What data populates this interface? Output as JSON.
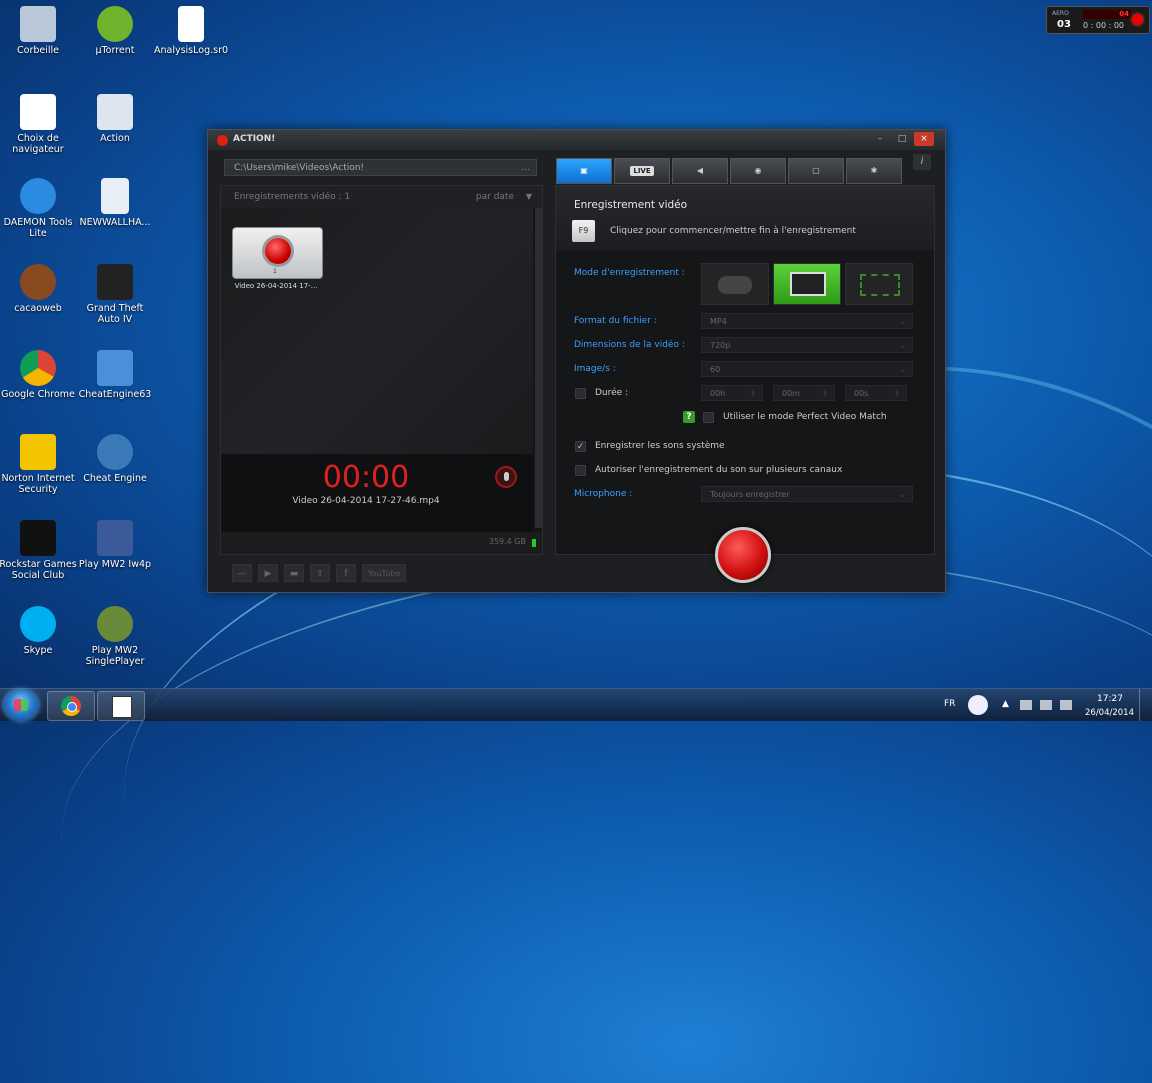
{
  "desktop_icons": [
    {
      "label": "Corbeille",
      "icon": "recycle-bin-icon",
      "color": "#b8c8d8"
    },
    {
      "label": "µTorrent",
      "icon": "utorrent-icon",
      "color": "#6fb42c"
    },
    {
      "label": "AnalysisLog.sr0",
      "icon": "file-icon",
      "color": "#ffffff"
    },
    {
      "label": "Choix de navigateur",
      "icon": "checklist-icon",
      "color": "#ffffff"
    },
    {
      "label": "Action",
      "icon": "calculator-icon",
      "color": "#dde6f0"
    },
    {
      "label": "DAEMON Tools Lite",
      "icon": "lightning-icon",
      "color": "#2a8be0"
    },
    {
      "label": "NEWWALLHA...",
      "icon": "settings-file-icon",
      "color": "#e8eef5"
    },
    {
      "label": "cacaoweb",
      "icon": "cacao-icon",
      "color": "#8a4a20"
    },
    {
      "label": "Grand Theft Auto IV",
      "icon": "gta-iv-icon",
      "color": "#222222"
    },
    {
      "label": "Google Chrome",
      "icon": "chrome-icon",
      "color": "#db4437"
    },
    {
      "label": "CheatEngine63",
      "icon": "computer-icon",
      "color": "#4a90d8"
    },
    {
      "label": "Norton Internet Security",
      "icon": "norton-icon",
      "color": "#f5c400"
    },
    {
      "label": "Cheat Engine",
      "icon": "gear-icon",
      "color": "#3a7ab8"
    },
    {
      "label": "Rockstar Games Social Club",
      "icon": "rockstar-icon",
      "color": "#111111"
    },
    {
      "label": "Play MW2 Iw4p",
      "icon": "mw2-icon",
      "color": "#3a5a9a"
    },
    {
      "label": "Skype",
      "icon": "skype-icon",
      "color": "#00aff0"
    },
    {
      "label": "Play MW2 SinglePlayer",
      "icon": "mw2-sp-icon",
      "color": "#6a8a3a"
    }
  ],
  "gadget": {
    "brand": "AERO",
    "left_num": "03",
    "right_num": "04",
    "time": "0 : 00 : 00"
  },
  "window": {
    "title": "ACTION!",
    "path": "C:\\Users\\mike\\Videos\\Action!",
    "path_more": "...",
    "list_header": "Enregistrements vidéo : 1",
    "sort_label": "par date",
    "thumb_number": "1",
    "thumb_label": "Video 26-04-2014 17-...",
    "timer": "00:00",
    "timer_file": "Video 26-04-2014 17-27-46.mp4",
    "free_space": "359.4 GB",
    "youtube_label": "YouTube",
    "tabs": [
      "record",
      "LIVE",
      "audio",
      "benchmark",
      "screenshot",
      "settings"
    ],
    "section_title": "Enregistrement vidéo",
    "hotkey": "F9",
    "hotkey_hint": "Cliquez pour commencer/mettre fin à l'enregistrement",
    "mode_label": "Mode d'enregistrement :",
    "format_label": "Format du fichier :",
    "format_value": "MP4",
    "dims_label": "Dimensions de la vidéo :",
    "dims_value": "720p",
    "fps_label": "Image/s :",
    "fps_value": "60",
    "duration_label": "Durée :",
    "duration_h": "00h",
    "duration_m": "00m",
    "duration_s": "00s",
    "pvm_label": "Utiliser le mode Perfect Video Match",
    "system_sounds_label": "Enregistrer les sons système",
    "multichannel_label": "Autoriser l'enregistrement du son sur plusieurs canaux",
    "mic_label": "Microphone :",
    "mic_value": "Toujours enregistrer",
    "help_mark": "?",
    "check_mark": "✓"
  },
  "taskbar": {
    "lang": "FR",
    "time": "17:27",
    "date": "26/04/2014"
  }
}
